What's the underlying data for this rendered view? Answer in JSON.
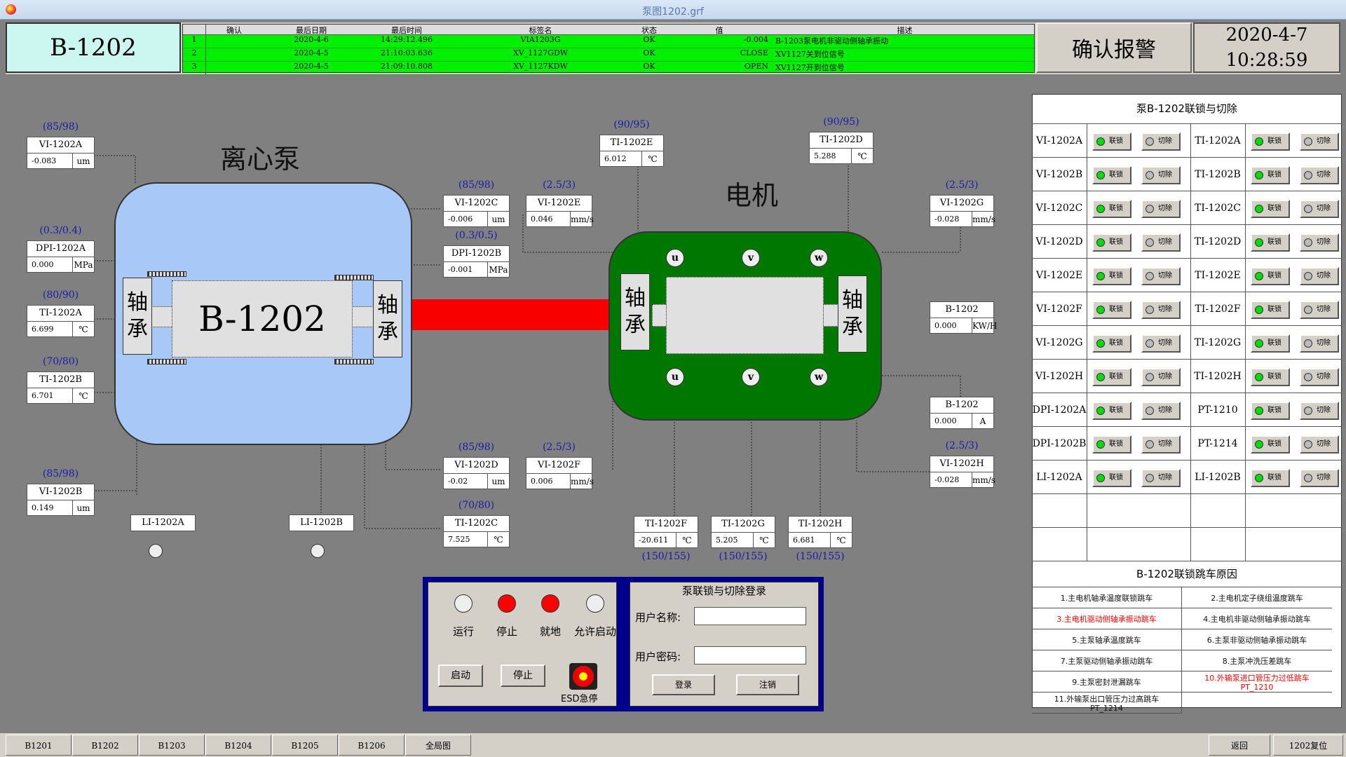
{
  "window": {
    "title": "泵图1202.grf"
  },
  "header": {
    "pump_id": "B-1202",
    "ack_label": "确认报警",
    "date": "2020-4-7",
    "time": "10:28:59"
  },
  "alarm_table": {
    "columns": [
      "确认",
      "最后日期",
      "最后时间",
      "标签名",
      "状态",
      "值",
      "描述"
    ],
    "rows": [
      {
        "no": "1",
        "date": "2020-4-6",
        "time": "14:29:12.496",
        "tag": "VIA1203G",
        "state": "OK",
        "value": "-0.004",
        "desc": "B-1203泵电机非驱动侧轴承振动"
      },
      {
        "no": "2",
        "date": "2020-4-5",
        "time": "21:10:03.636",
        "tag": "XV_1127GDW",
        "state": "OK",
        "value": "CLOSE",
        "desc": "XV1127关到位信号"
      },
      {
        "no": "3",
        "date": "2020-4-5",
        "time": "21:09:10.808",
        "tag": "XV_1127KDW",
        "state": "OK",
        "value": "OPEN",
        "desc": "XV1127开到位信号"
      }
    ]
  },
  "diagram": {
    "pump_title": "离心泵",
    "motor_title": "电机",
    "pump_label": "B-1202",
    "bearing_text_top": "轴",
    "bearing_text_bottom": "承",
    "terminals": [
      "u",
      "v",
      "w",
      "u",
      "v",
      "w"
    ]
  },
  "tags": {
    "vi1202a": {
      "name": "VI-1202A",
      "value": "-0.083",
      "unit": "um",
      "limit": "(85/98)"
    },
    "dpi1202a": {
      "name": "DPI-1202A",
      "value": "0.000",
      "unit": "MPa",
      "limit": "(0.3/0.4)"
    },
    "ti1202a": {
      "name": "TI-1202A",
      "value": "6.699",
      "unit": "℃",
      "limit": "(80/90)"
    },
    "ti1202b": {
      "name": "TI-1202B",
      "value": "6.701",
      "unit": "℃",
      "limit": "(70/80)"
    },
    "vi1202b": {
      "name": "VI-1202B",
      "value": "0.149",
      "unit": "um",
      "limit": "(85/98)"
    },
    "vi1202c": {
      "name": "VI-1202C",
      "value": "-0.006",
      "unit": "um",
      "limit": "(85/98)"
    },
    "vi1202e": {
      "name": "VI-1202E",
      "value": "0.046",
      "unit": "mm/s",
      "limit": "(2.5/3)"
    },
    "dpi1202b": {
      "name": "DPI-1202B",
      "value": "-0.001",
      "unit": "MPa",
      "limit": "(0.3/0.5)"
    },
    "ti1202e": {
      "name": "TI-1202E",
      "value": "6.012",
      "unit": "℃",
      "limit": "(90/95)"
    },
    "ti1202d": {
      "name": "TI-1202D",
      "value": "5.288",
      "unit": "℃",
      "limit": "(90/95)"
    },
    "vi1202g": {
      "name": "VI-1202G",
      "value": "-0.028",
      "unit": "mm/s",
      "limit": "(2.5/3)"
    },
    "b1202kw": {
      "name": "B-1202",
      "value": "0.000",
      "unit": "KW/H"
    },
    "b1202a": {
      "name": "B-1202",
      "value": "0.000",
      "unit": "A"
    },
    "vi1202h": {
      "name": "VI-1202H",
      "value": "-0.028",
      "unit": "mm/s",
      "limit": "(2.5/3)"
    },
    "vi1202d": {
      "name": "VI-1202D",
      "value": "-0.02",
      "unit": "um",
      "limit": "(85/98)"
    },
    "vi1202f": {
      "name": "VI-1202F",
      "value": "0.006",
      "unit": "mm/s",
      "limit": "(2.5/3)"
    },
    "ti1202c": {
      "name": "TI-1202C",
      "value": "7.525",
      "unit": "℃",
      "limit": "(70/80)"
    },
    "ti1202f": {
      "name": "TI-1202F",
      "value": "-20.611",
      "unit": "℃",
      "limit": "(150/155)"
    },
    "ti1202g": {
      "name": "TI-1202G",
      "value": "5.205",
      "unit": "℃",
      "limit": "(150/155)"
    },
    "ti1202h": {
      "name": "TI-1202H",
      "value": "6.681",
      "unit": "℃",
      "limit": "(150/155)"
    },
    "li1202a": {
      "name": "LI-1202A"
    },
    "li1202b": {
      "name": "LI-1202B"
    }
  },
  "control": {
    "lamps": [
      "运行",
      "停止",
      "就地",
      "允许启动"
    ],
    "lamp_colors": [
      "#eeeeee",
      "#ff0000",
      "#ff0000",
      "#eeeeee"
    ],
    "start": "启动",
    "stop": "停止",
    "esd": "ESD急停"
  },
  "login": {
    "title": "泵联锁与切除登录",
    "user_label": "用户名称:",
    "pass_label": "用户密码:",
    "login_btn": "登录",
    "logout_btn": "注销"
  },
  "interlock": {
    "title": "泵B-1202联锁与切除",
    "on_label": "联锁",
    "off_label": "切除",
    "left": [
      "VI-1202A",
      "VI-1202B",
      "VI-1202C",
      "VI-1202D",
      "VI-1202E",
      "VI-1202F",
      "VI-1202G",
      "VI-1202H",
      "DPI-1202A",
      "DPI-1202B",
      "LI-1202A"
    ],
    "right": [
      "TI-1202A",
      "TI-1202B",
      "TI-1202C",
      "TI-1202D",
      "TI-1202E",
      "TI-1202F",
      "TI-1202G",
      "TI-1202H",
      "PT-1210",
      "PT-1214",
      "LI-1202B"
    ],
    "trip_title": "B-1202联锁跳车原因",
    "reasons": [
      {
        "text": "1.主电机轴承温度联锁跳车",
        "alarm": false
      },
      {
        "text": "2.主电机定子绕组温度跳车",
        "alarm": false
      },
      {
        "text": "3.主电机驱动侧轴承振动跳车",
        "alarm": true
      },
      {
        "text": "4.主电机非驱动侧轴承振动跳车",
        "alarm": false
      },
      {
        "text": "5.主泵轴承温度跳车",
        "alarm": false
      },
      {
        "text": "6.主泵非驱动侧轴承振动跳车",
        "alarm": false
      },
      {
        "text": "7.主泵驱动侧轴承振动跳车",
        "alarm": false
      },
      {
        "text": "8.主泵冲洗压差跳车",
        "alarm": false
      },
      {
        "text": "9.主泵密封泄漏跳车",
        "alarm": false
      },
      {
        "text": "10.外输泵进口管压力过低跳车",
        "sub": "PT_1210",
        "alarm": true
      },
      {
        "text": "11.外输泵出口管压力过高跳车",
        "sub": "PT_1214",
        "alarm": false
      }
    ],
    "green": "#00dd00",
    "red": "#ff0000"
  },
  "nav": {
    "tabs": [
      "B1201",
      "B1202",
      "B1203",
      "B1204",
      "B1205",
      "B1206",
      "全局图"
    ],
    "back": "返回",
    "reset": "1202复位"
  }
}
